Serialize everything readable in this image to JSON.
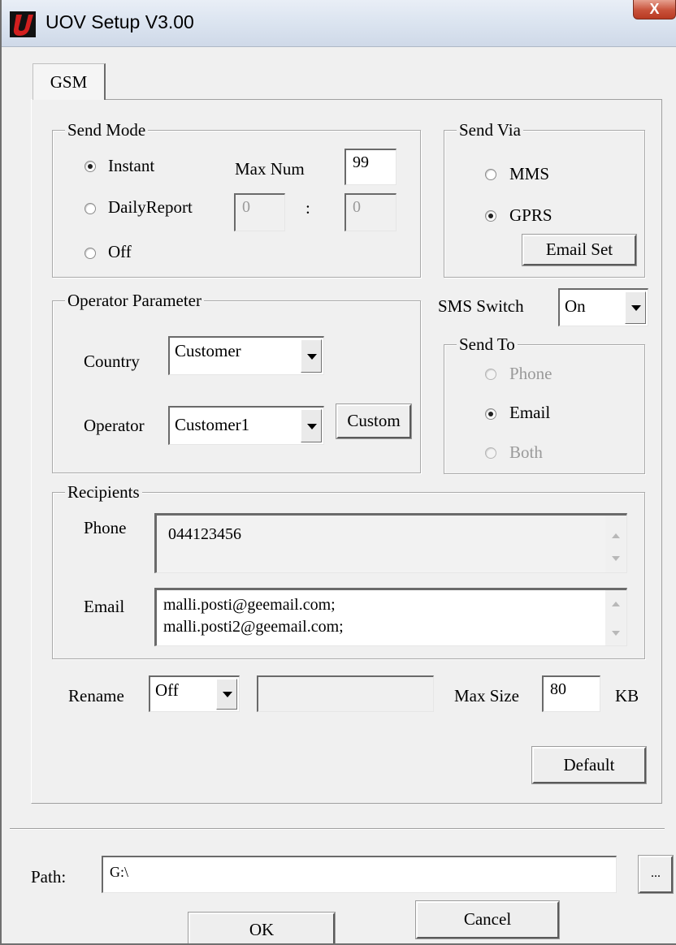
{
  "window": {
    "title": "UOV Setup V3.00",
    "close_label": "X"
  },
  "tabs": [
    {
      "label": "GSM",
      "selected": true
    }
  ],
  "send_mode": {
    "legend": "Send Mode",
    "options": [
      {
        "label": "Instant",
        "checked": true
      },
      {
        "label": "DailyReport",
        "checked": false
      },
      {
        "label": "Off",
        "checked": false
      }
    ],
    "max_num_label": "Max Num",
    "max_num_value": "99",
    "daily_hour": "0",
    "time_separator": ":",
    "daily_minute": "0"
  },
  "send_via": {
    "legend": "Send Via",
    "options": [
      {
        "label": "MMS",
        "checked": false
      },
      {
        "label": "GPRS",
        "checked": true
      }
    ],
    "email_set_label": "Email Set"
  },
  "operator_parameter": {
    "legend": "Operator Parameter",
    "country_label": "Country",
    "country_value": "Customer",
    "operator_label": "Operator",
    "operator_value": "Customer1",
    "custom_label": "Custom"
  },
  "sms_switch": {
    "label": "SMS Switch",
    "value": "On"
  },
  "send_to": {
    "legend": "Send To",
    "options": [
      {
        "label": "Phone",
        "checked": false,
        "enabled": false
      },
      {
        "label": "Email",
        "checked": true,
        "enabled": true
      },
      {
        "label": "Both",
        "checked": false,
        "enabled": false
      }
    ]
  },
  "recipients": {
    "legend": "Recipients",
    "phone_label": "Phone",
    "phone_value": "044123456",
    "email_label": "Email",
    "email_lines": [
      "malli.posti@geemail.com;",
      "malli.posti2@geemail.com;"
    ]
  },
  "rename": {
    "label": "Rename",
    "value": "Off",
    "text_value": ""
  },
  "max_size": {
    "label": "Max Size",
    "value": "80",
    "unit": "KB"
  },
  "default_label": "Default",
  "path": {
    "label": "Path:",
    "value": "G:\\",
    "browse_label": "..."
  },
  "buttons": {
    "ok": "OK",
    "cancel": "Cancel"
  }
}
